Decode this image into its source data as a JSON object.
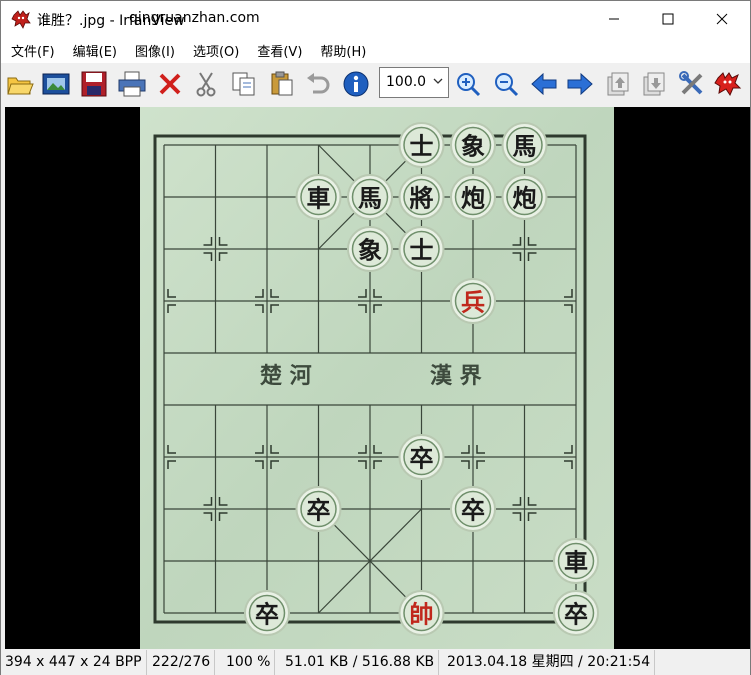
{
  "window": {
    "title": "谁胜？.jpg - IrfanView",
    "watermark": "qingruanzhan.com"
  },
  "menu": [
    "文件(F)",
    "编辑(E)",
    "图像(I)",
    "选项(O)",
    "查看(V)",
    "帮助(H)"
  ],
  "toolbar": {
    "zoom_value": "100.0",
    "buttons": [
      "open-folder",
      "slideshow",
      "save",
      "print",
      "delete",
      "cut",
      "copy",
      "paste",
      "undo",
      "info",
      "zoom-in",
      "zoom-out",
      "previous",
      "next",
      "first-page",
      "last-page",
      "properties",
      "exit"
    ]
  },
  "board": {
    "river_left": "楚  河",
    "river_right": "漢  界",
    "pieces": [
      {
        "char": "士",
        "color": "black",
        "col": 5,
        "row": 0
      },
      {
        "char": "象",
        "color": "black",
        "col": 6,
        "row": 0
      },
      {
        "char": "馬",
        "color": "black",
        "col": 7,
        "row": 0
      },
      {
        "char": "車",
        "color": "black",
        "col": 3,
        "row": 1
      },
      {
        "char": "馬",
        "color": "black",
        "col": 4,
        "row": 1
      },
      {
        "char": "將",
        "color": "black",
        "col": 5,
        "row": 1
      },
      {
        "char": "炮",
        "color": "black",
        "col": 6,
        "row": 1
      },
      {
        "char": "炮",
        "color": "black",
        "col": 7,
        "row": 1
      },
      {
        "char": "象",
        "color": "black",
        "col": 4,
        "row": 2
      },
      {
        "char": "士",
        "color": "black",
        "col": 5,
        "row": 2
      },
      {
        "char": "兵",
        "color": "red",
        "col": 6,
        "row": 3
      },
      {
        "char": "卒",
        "color": "black",
        "col": 5,
        "row": 6
      },
      {
        "char": "卒",
        "color": "black",
        "col": 3,
        "row": 7
      },
      {
        "char": "卒",
        "color": "black",
        "col": 6,
        "row": 7
      },
      {
        "char": "車",
        "color": "black",
        "col": 8,
        "row": 8
      },
      {
        "char": "卒",
        "color": "black",
        "col": 2,
        "row": 9
      },
      {
        "char": "帥",
        "color": "red",
        "col": 5,
        "row": 9
      },
      {
        "char": "卒",
        "color": "black",
        "col": 8,
        "row": 9
      }
    ]
  },
  "status": {
    "dimensions": "394 x 447 x 24 BPP",
    "index": "222/276",
    "zoom": "100 %",
    "size": "51.01 KB / 516.88 KB",
    "datetime": "2013.04.18 星期四 / 20:21:54"
  },
  "colors": {
    "board_bg": "#c8dcc6",
    "piece_red": "#c0281c",
    "piece_black": "#1a1a1a"
  }
}
